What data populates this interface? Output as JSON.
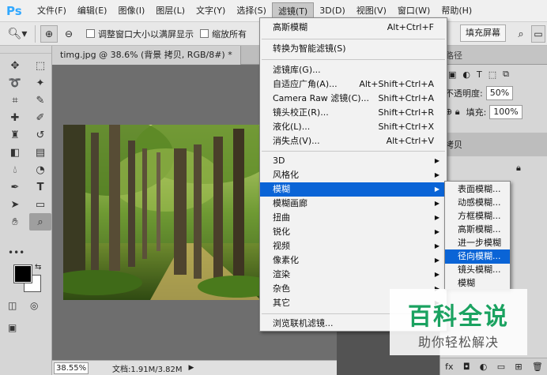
{
  "app": {
    "logo": "Ps"
  },
  "menubar": {
    "items": [
      "文件(F)",
      "编辑(E)",
      "图像(I)",
      "图层(L)",
      "文字(Y)",
      "选择(S)",
      "滤镜(T)",
      "3D(D)",
      "视图(V)",
      "窗口(W)",
      "帮助(H)"
    ],
    "active_index": 6
  },
  "options": {
    "resize_windows_label": "调整窗口大小以满屏显示",
    "zoom_all_label": "缩放所有",
    "fill_screen_label": "填充屏幕"
  },
  "document": {
    "tab_title": "timg.jpg @ 38.6% (背景 拷贝, RGB/8#) *",
    "zoom": "38.55%",
    "doc_info": "文档:1.91M/3.82M"
  },
  "filter_menu": {
    "top": [
      {
        "label": "高斯模糊",
        "shortcut": "Alt+Ctrl+F"
      }
    ],
    "smart": [
      {
        "label": "转换为智能滤镜(S)",
        "shortcut": ""
      }
    ],
    "group1": [
      {
        "label": "滤镜库(G)...",
        "shortcut": ""
      },
      {
        "label": "自适应广角(A)...",
        "shortcut": "Alt+Shift+Ctrl+A"
      },
      {
        "label": "Camera Raw 滤镜(C)...",
        "shortcut": "Shift+Ctrl+A"
      },
      {
        "label": "镜头校正(R)...",
        "shortcut": "Shift+Ctrl+R"
      },
      {
        "label": "液化(L)...",
        "shortcut": "Shift+Ctrl+X"
      },
      {
        "label": "消失点(V)...",
        "shortcut": "Alt+Ctrl+V"
      }
    ],
    "group2": [
      "3D",
      "风格化",
      "模糊",
      "模糊画廊",
      "扭曲",
      "锐化",
      "视频",
      "像素化",
      "渲染",
      "杂色",
      "其它"
    ],
    "highlight_label": "模糊",
    "browse": "浏览联机滤镜..."
  },
  "blur_submenu": {
    "items": [
      "表面模糊...",
      "动感模糊...",
      "方框模糊...",
      "高斯模糊...",
      "进一步模糊",
      "径向模糊...",
      "镜头模糊...",
      "模糊"
    ],
    "highlight_index": 5
  },
  "panel": {
    "tab_label": "路径",
    "opacity_label": "不透明度:",
    "opacity_value": "50%",
    "fill_label": "填充:",
    "fill_value": "100%",
    "layer_name": "拷贝"
  },
  "watermark": {
    "title": "百科全说",
    "subtitle": "助你轻松解决"
  },
  "colors": {
    "highlight": "#0a64d6",
    "watermark_green": "#1aa260",
    "ps_blue": "#31a8ff"
  }
}
